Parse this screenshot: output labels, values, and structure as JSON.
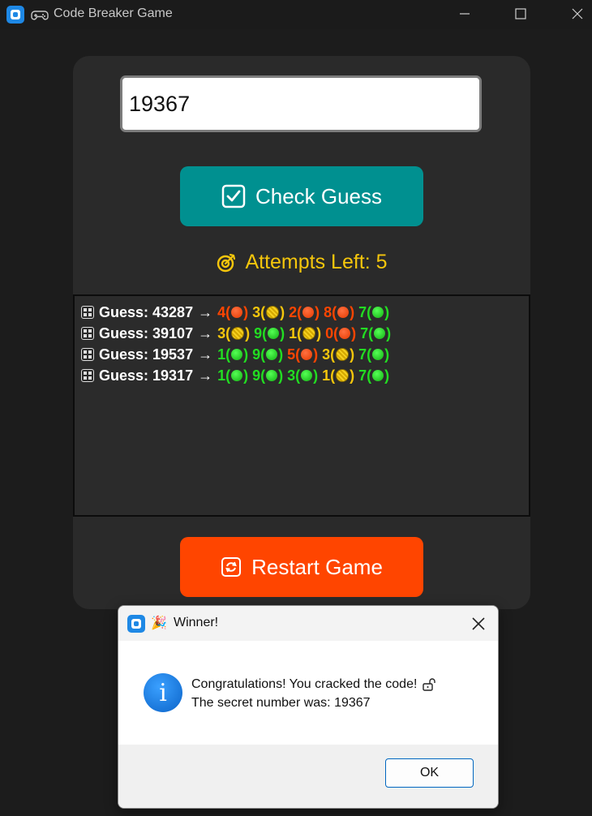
{
  "window": {
    "title": "Code Breaker Game",
    "icons": {
      "app": "app-icon",
      "game": "game-controller-icon"
    }
  },
  "main": {
    "guess_value": "19367",
    "check_button_label": "Check Guess",
    "attempts_label": "Attempts Left: 5",
    "restart_button_label": "Restart Game",
    "colors": {
      "check_button": "#009090",
      "restart_button": "#ff4500",
      "attempts": "#f5c60c",
      "correct": "#22dd22",
      "misplaced": "#f5c60c",
      "wrong": "#ff4500"
    }
  },
  "history": [
    {
      "prefix": "Guess: 43287",
      "arrow": "→",
      "digits": [
        {
          "d": "4",
          "status": "wrong"
        },
        {
          "d": "3",
          "status": "misplaced"
        },
        {
          "d": "2",
          "status": "wrong"
        },
        {
          "d": "8",
          "status": "wrong"
        },
        {
          "d": "7",
          "status": "correct"
        }
      ]
    },
    {
      "prefix": "Guess: 39107",
      "arrow": "→",
      "digits": [
        {
          "d": "3",
          "status": "misplaced"
        },
        {
          "d": "9",
          "status": "correct"
        },
        {
          "d": "1",
          "status": "misplaced"
        },
        {
          "d": "0",
          "status": "wrong"
        },
        {
          "d": "7",
          "status": "correct"
        }
      ]
    },
    {
      "prefix": "Guess: 19537",
      "arrow": "→",
      "digits": [
        {
          "d": "1",
          "status": "correct"
        },
        {
          "d": "9",
          "status": "correct"
        },
        {
          "d": "5",
          "status": "wrong"
        },
        {
          "d": "3",
          "status": "misplaced"
        },
        {
          "d": "7",
          "status": "correct"
        }
      ]
    },
    {
      "prefix": "Guess: 19317",
      "arrow": "→",
      "digits": [
        {
          "d": "1",
          "status": "correct"
        },
        {
          "d": "9",
          "status": "correct"
        },
        {
          "d": "3",
          "status": "correct"
        },
        {
          "d": "1",
          "status": "misplaced"
        },
        {
          "d": "7",
          "status": "correct"
        }
      ]
    }
  ],
  "dialog": {
    "party_emoji": "🎉",
    "title": "Winner!",
    "message_line1": "Congratulations! You cracked the code!",
    "message_line2": "The secret number was: 19367",
    "ok_label": "OK"
  }
}
